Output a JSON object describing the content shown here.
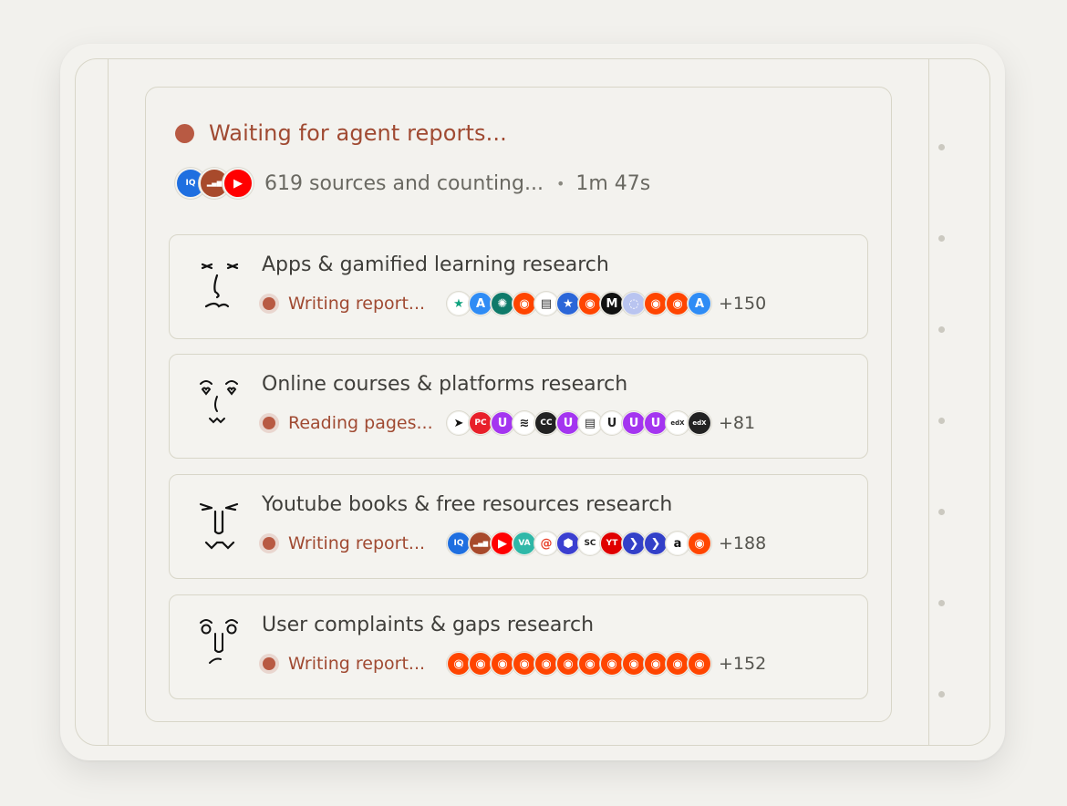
{
  "status": {
    "title": "Waiting for agent reports...",
    "sources_text": "619 sources and counting...",
    "separator": "•",
    "elapsed": "1m 47s",
    "source_icons": [
      {
        "icon": "logo-iq-icon",
        "bg": "#1f6fe0",
        "fg": "#ffffff",
        "glyph": "IQ"
      },
      {
        "icon": "bar-chart-icon",
        "bg": "#a84a2c",
        "fg": "#ffffff",
        "glyph": "▂▄▆"
      },
      {
        "icon": "youtube-icon",
        "bg": "#ff0000",
        "fg": "#ffffff",
        "glyph": "▶"
      }
    ]
  },
  "agents": [
    {
      "title": "Apps & gamified learning research",
      "status": "Writing report...",
      "more": "+150",
      "face": "sleepy",
      "sources": [
        {
          "icon": "star-icon",
          "bg": "#ffffff",
          "fg": "#10a37f",
          "glyph": "★"
        },
        {
          "icon": "app-store-icon",
          "bg": "#2f8cf5",
          "fg": "#ffffff",
          "glyph": "A"
        },
        {
          "icon": "globe-icon",
          "bg": "#0f7a6a",
          "fg": "#ffffff",
          "glyph": "✺"
        },
        {
          "icon": "reddit-icon",
          "bg": "#ff4500",
          "fg": "#ffffff",
          "glyph": "◉"
        },
        {
          "icon": "document-icon",
          "bg": "#ffffff",
          "fg": "#333333",
          "glyph": "▤"
        },
        {
          "icon": "shield-star-icon",
          "bg": "#2b66d8",
          "fg": "#ffffff",
          "glyph": "★"
        },
        {
          "icon": "reddit-icon",
          "bg": "#ff4500",
          "fg": "#ffffff",
          "glyph": "◉"
        },
        {
          "icon": "medium-icon",
          "bg": "#111111",
          "fg": "#ffffff",
          "glyph": "M"
        },
        {
          "icon": "circle-logo-icon",
          "bg": "#b9c4f0",
          "fg": "#ffffff",
          "glyph": "◌"
        },
        {
          "icon": "reddit-icon",
          "bg": "#ff4500",
          "fg": "#ffffff",
          "glyph": "◉"
        },
        {
          "icon": "reddit-icon",
          "bg": "#ff4500",
          "fg": "#ffffff",
          "glyph": "◉"
        },
        {
          "icon": "app-store-icon",
          "bg": "#2f8cf5",
          "fg": "#ffffff",
          "glyph": "A"
        }
      ]
    },
    {
      "title": "Online courses & platforms research",
      "status": "Reading pages...",
      "more": "+81",
      "face": "hearts",
      "sources": [
        {
          "icon": "arrow-logo-icon",
          "bg": "#ffffff",
          "fg": "#111111",
          "glyph": "➤"
        },
        {
          "icon": "pc-logo-icon",
          "bg": "#e8202a",
          "fg": "#ffffff",
          "glyph": "PC"
        },
        {
          "icon": "udemy-icon",
          "bg": "#a435f0",
          "fg": "#ffffff",
          "glyph": "U"
        },
        {
          "icon": "layers-icon",
          "bg": "#ffffff",
          "fg": "#222222",
          "glyph": "≋"
        },
        {
          "icon": "cc-icon",
          "bg": "#222222",
          "fg": "#ffffff",
          "glyph": "CC"
        },
        {
          "icon": "udemy-icon",
          "bg": "#a435f0",
          "fg": "#ffffff",
          "glyph": "U"
        },
        {
          "icon": "document-icon",
          "bg": "#ffffff",
          "fg": "#333333",
          "glyph": "▤"
        },
        {
          "icon": "udemy-outline-icon",
          "bg": "#ffffff",
          "fg": "#222222",
          "glyph": "U"
        },
        {
          "icon": "udemy-icon",
          "bg": "#a435f0",
          "fg": "#ffffff",
          "glyph": "U"
        },
        {
          "icon": "udemy-icon",
          "bg": "#a435f0",
          "fg": "#ffffff",
          "glyph": "U"
        },
        {
          "icon": "edx-icon",
          "bg": "#ffffff",
          "fg": "#222222",
          "glyph": "edX"
        },
        {
          "icon": "edx-icon",
          "bg": "#222222",
          "fg": "#ffffff",
          "glyph": "edX"
        }
      ]
    },
    {
      "title": "Youtube books & free resources research",
      "status": "Writing report...",
      "more": "+188",
      "face": "fangs",
      "sources": [
        {
          "icon": "logo-iq-icon",
          "bg": "#1f6fe0",
          "fg": "#ffffff",
          "glyph": "IQ"
        },
        {
          "icon": "bar-chart-icon",
          "bg": "#a84a2c",
          "fg": "#ffffff",
          "glyph": "▂▄▆"
        },
        {
          "icon": "youtube-icon",
          "bg": "#ff0000",
          "fg": "#ffffff",
          "glyph": "▶"
        },
        {
          "icon": "va-logo-icon",
          "bg": "#2fb8a8",
          "fg": "#ffffff",
          "glyph": "VA"
        },
        {
          "icon": "spiral-icon",
          "bg": "#ffffff",
          "fg": "#e8402a",
          "glyph": "@"
        },
        {
          "icon": "hexagon-logo-icon",
          "bg": "#3b3fd0",
          "fg": "#ffffff",
          "glyph": "⬢"
        },
        {
          "icon": "sc-logo-icon",
          "bg": "#ffffff",
          "fg": "#222222",
          "glyph": "SC"
        },
        {
          "icon": "yt-logo-icon",
          "bg": "#e00000",
          "fg": "#ffffff",
          "glyph": "YT"
        },
        {
          "icon": "chevron-logo-icon",
          "bg": "#3340c8",
          "fg": "#ffffff",
          "glyph": "❯"
        },
        {
          "icon": "chevron-logo-icon",
          "bg": "#3340c8",
          "fg": "#ffffff",
          "glyph": "❯"
        },
        {
          "icon": "amazon-icon",
          "bg": "#ffffff",
          "fg": "#111111",
          "glyph": "a"
        },
        {
          "icon": "reddit-icon",
          "bg": "#ff4500",
          "fg": "#ffffff",
          "glyph": "◉"
        }
      ]
    },
    {
      "title": "User complaints & gaps research",
      "status": "Writing report...",
      "more": "+152",
      "face": "surprised",
      "sources": [
        {
          "icon": "reddit-icon",
          "bg": "#ff4500",
          "fg": "#ffffff",
          "glyph": "◉"
        },
        {
          "icon": "reddit-icon",
          "bg": "#ff4500",
          "fg": "#ffffff",
          "glyph": "◉"
        },
        {
          "icon": "reddit-icon",
          "bg": "#ff4500",
          "fg": "#ffffff",
          "glyph": "◉"
        },
        {
          "icon": "reddit-icon",
          "bg": "#ff4500",
          "fg": "#ffffff",
          "glyph": "◉"
        },
        {
          "icon": "reddit-icon",
          "bg": "#ff4500",
          "fg": "#ffffff",
          "glyph": "◉"
        },
        {
          "icon": "reddit-icon",
          "bg": "#ff4500",
          "fg": "#ffffff",
          "glyph": "◉"
        },
        {
          "icon": "reddit-icon",
          "bg": "#ff4500",
          "fg": "#ffffff",
          "glyph": "◉"
        },
        {
          "icon": "reddit-icon",
          "bg": "#ff4500",
          "fg": "#ffffff",
          "glyph": "◉"
        },
        {
          "icon": "reddit-icon",
          "bg": "#ff4500",
          "fg": "#ffffff",
          "glyph": "◉"
        },
        {
          "icon": "reddit-icon",
          "bg": "#ff4500",
          "fg": "#ffffff",
          "glyph": "◉"
        },
        {
          "icon": "reddit-icon",
          "bg": "#ff4500",
          "fg": "#ffffff",
          "glyph": "◉"
        },
        {
          "icon": "reddit-icon",
          "bg": "#ff4500",
          "fg": "#ffffff",
          "glyph": "◉"
        }
      ]
    }
  ]
}
